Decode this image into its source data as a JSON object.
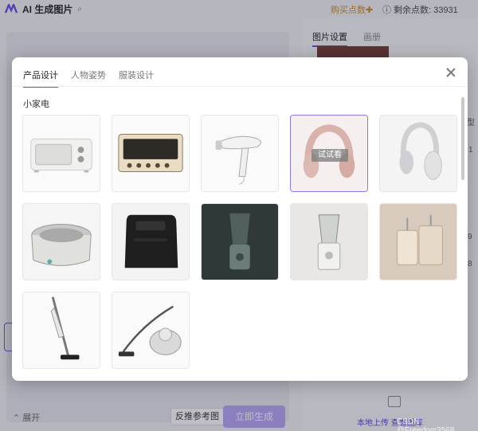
{
  "app": {
    "title": "AI 生成图片",
    "buy_points": "购买点数✚",
    "remaining_points": "ⓘ 剩余点数: 33931",
    "right_tabs": [
      "图片设置",
      "画册"
    ],
    "expand_label": "⌃ 展开",
    "reverse_ref_label": "反推参考图",
    "generate_label": "立即生成",
    "upload_label": "本地上传",
    "view_label": "查看图库",
    "side_type": "型",
    "side_num1": "1",
    "side_num2": "9",
    "side_num3": "8"
  },
  "watermark": "CSDN @Freedom3568",
  "modal": {
    "tabs": [
      "产品设计",
      "人物姿势",
      "服装设计"
    ],
    "active_tab": 0,
    "section_label": "小家电",
    "try_label": "试试看",
    "items": [
      {
        "name": "toaster-oven-white"
      },
      {
        "name": "toaster-oven-cream"
      },
      {
        "name": "hair-dryer"
      },
      {
        "name": "headphones-pink"
      },
      {
        "name": "headphones-white"
      },
      {
        "name": "hot-pot"
      },
      {
        "name": "air-fryer"
      },
      {
        "name": "blender-dark"
      },
      {
        "name": "blender-light"
      },
      {
        "name": "luggage"
      },
      {
        "name": "stick-vacuum"
      },
      {
        "name": "canister-vacuum"
      }
    ]
  },
  "colors": {
    "accent": "#6b4de6",
    "generate_bg": "#b7a6f5",
    "buy_color": "#d38b20"
  }
}
